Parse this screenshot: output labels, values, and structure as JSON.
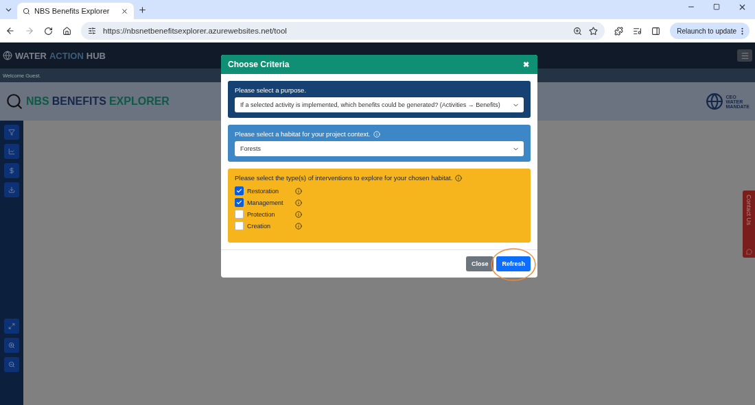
{
  "browser": {
    "tabs": [
      {
        "title": "NBS Benefits Explorer",
        "selected": true
      }
    ],
    "url": "https://nbsnetbenefitsexplorer.azurewebsites.net/tool",
    "update_button": "Relaunch to update"
  },
  "site": {
    "logo": [
      {
        "text": "WATER",
        "kind": "light"
      },
      {
        "text": "ACTION",
        "kind": "accent"
      },
      {
        "text": "HUB",
        "kind": "light"
      }
    ],
    "welcome": "Welcome Guest.",
    "title": [
      {
        "text": "NBS",
        "kind": "green"
      },
      {
        "text": "BENEFITS",
        "kind": "navy"
      },
      {
        "text": "EXPLORER",
        "kind": "green"
      }
    ],
    "partner_logo": [
      "CEO",
      "WATER",
      "MANDATE"
    ],
    "contact_tab": "Contact Us"
  },
  "dialog": {
    "title": "Choose Criteria",
    "close_icon": "✖",
    "purpose": {
      "label": "Please select a purpose.",
      "value": "If a selected activity is implemented, which benefits could be generated? (Activities → Benefits)"
    },
    "habitat": {
      "label": "Please select a habitat for your project context.",
      "value": "Forests"
    },
    "interventions": {
      "label": "Please select the type(s) of interventions to explore for your chosen habitat.",
      "options": [
        {
          "label": "Restoration",
          "checked": true
        },
        {
          "label": "Management",
          "checked": true
        },
        {
          "label": "Protection",
          "checked": false
        },
        {
          "label": "Creation",
          "checked": false
        }
      ]
    },
    "buttons": [
      {
        "label": "Close",
        "kind": "secondary"
      },
      {
        "label": "Refresh",
        "kind": "primary",
        "highlighted": true
      }
    ]
  }
}
